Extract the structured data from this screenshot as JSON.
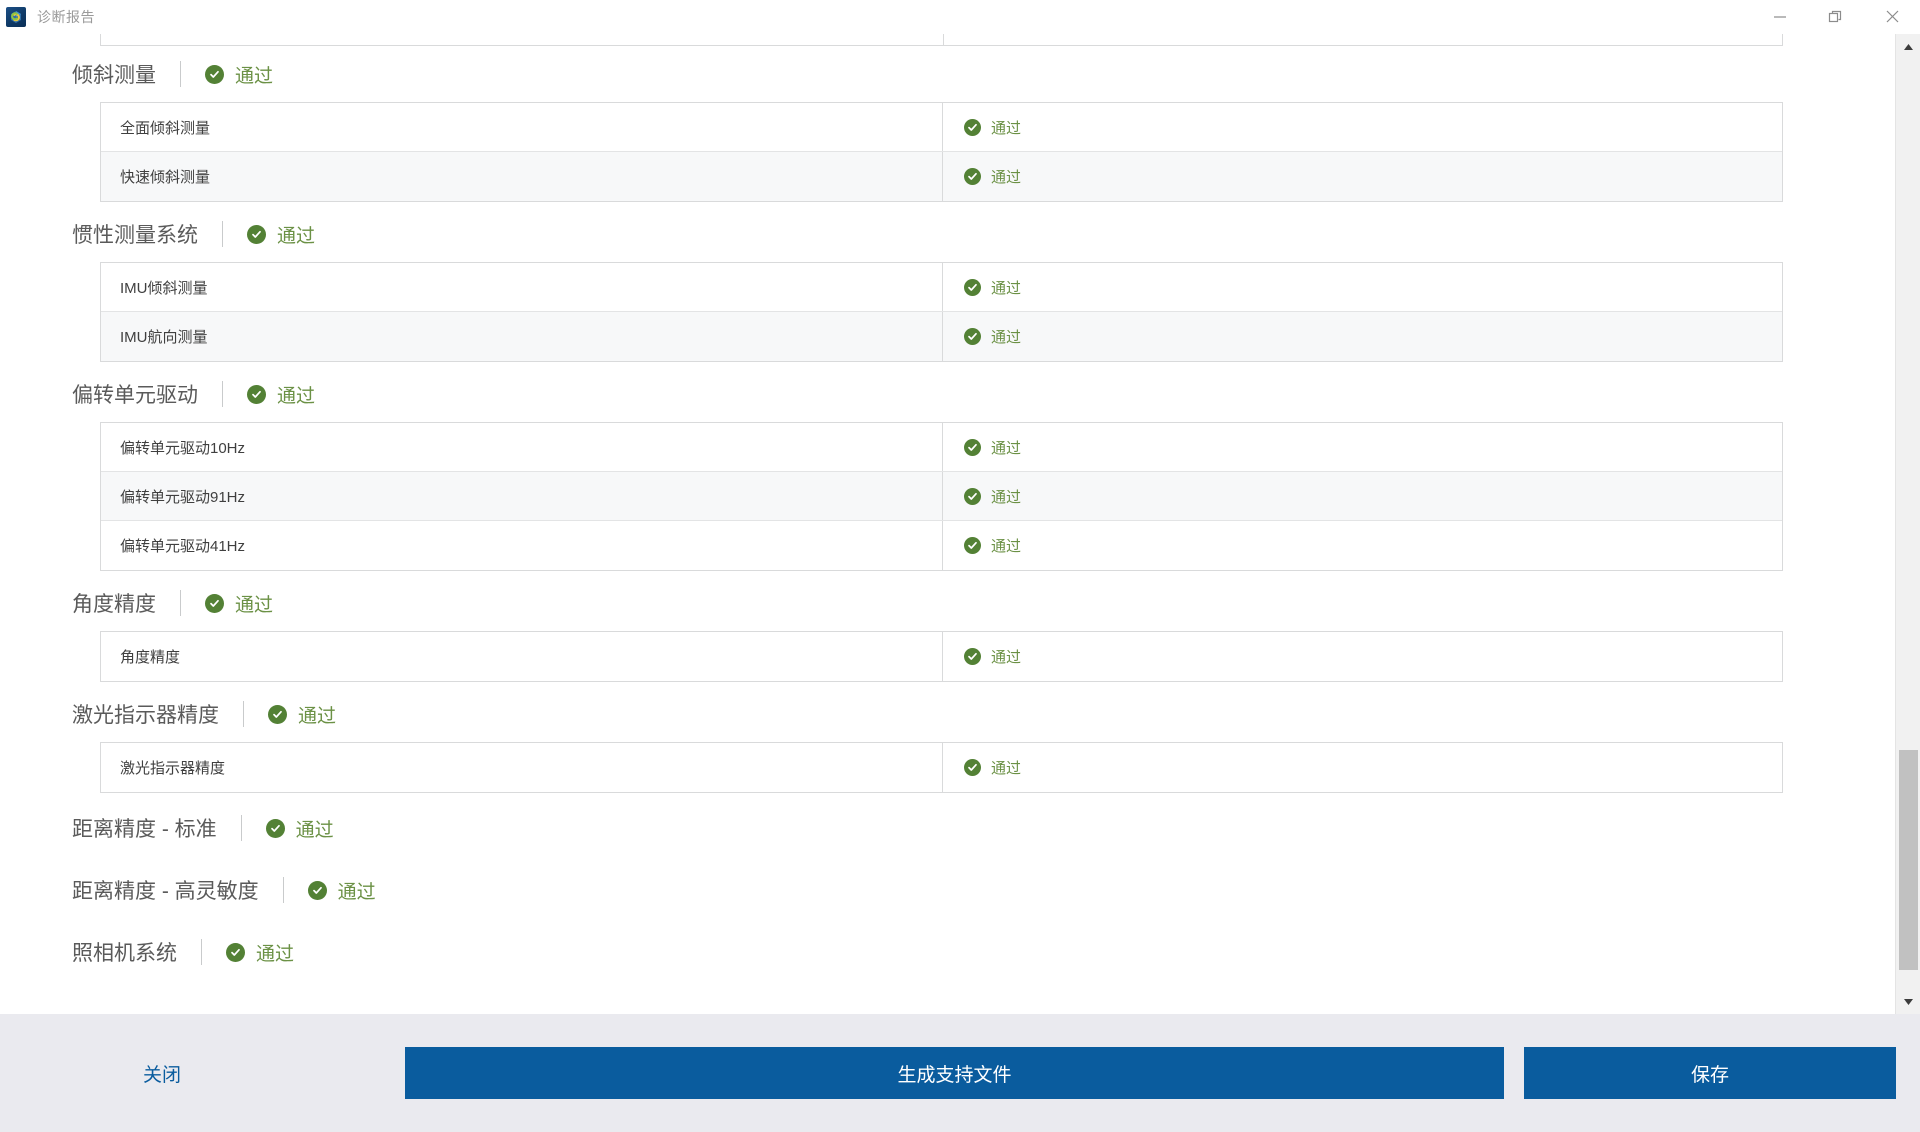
{
  "window": {
    "title": "诊断报告",
    "icon": "app-logo-icon",
    "controls": {
      "minimize": "minimize-icon",
      "restore": "restore-icon",
      "close": "close-icon"
    }
  },
  "status_label": "通过",
  "colors": {
    "status_green": "#6b9145",
    "check_circle": "#538135",
    "primary_blue": "#0a5c9e",
    "footer_bg": "#eaeaef",
    "row_alt": "#f7f8f9",
    "border": "#d9dadb"
  },
  "sections": [
    {
      "title": "倾斜测量",
      "status": "通过",
      "rows": [
        {
          "name": "全面倾斜测量",
          "status": "通过"
        },
        {
          "name": "快速倾斜测量",
          "status": "通过"
        }
      ]
    },
    {
      "title": "惯性测量系统",
      "status": "通过",
      "rows": [
        {
          "name": "IMU倾斜测量",
          "status": "通过"
        },
        {
          "name": "IMU航向测量",
          "status": "通过"
        }
      ]
    },
    {
      "title": "偏转单元驱动",
      "status": "通过",
      "rows": [
        {
          "name": "偏转单元驱动10Hz",
          "status": "通过"
        },
        {
          "name": "偏转单元驱动91Hz",
          "status": "通过"
        },
        {
          "name": "偏转单元驱动41Hz",
          "status": "通过"
        }
      ]
    },
    {
      "title": "角度精度",
      "status": "通过",
      "rows": [
        {
          "name": "角度精度",
          "status": "通过"
        }
      ]
    },
    {
      "title": "激光指示器精度",
      "status": "通过",
      "rows": [
        {
          "name": "激光指示器精度",
          "status": "通过"
        }
      ]
    },
    {
      "title": "距离精度 - 标准",
      "status": "通过",
      "rows": []
    },
    {
      "title": "距离精度 - 高灵敏度",
      "status": "通过",
      "rows": []
    },
    {
      "title": "照相机系统",
      "status": "通过",
      "rows": []
    }
  ],
  "scrollbar": {
    "up_arrow": "chevron-up-icon",
    "down_arrow": "chevron-down-icon"
  },
  "footer": {
    "close_label": "关闭",
    "support_label": "生成支持文件",
    "save_label": "保存"
  }
}
